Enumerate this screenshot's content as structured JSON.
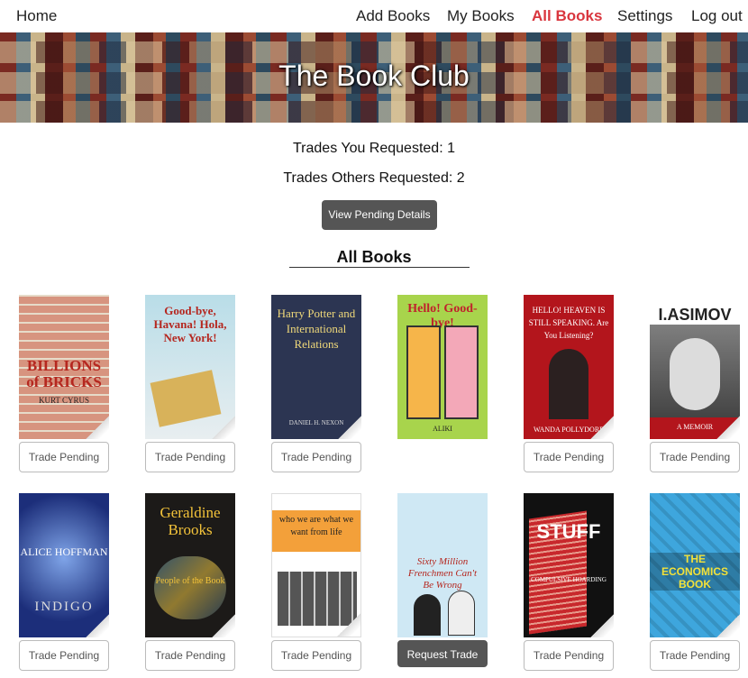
{
  "nav": {
    "home": "Home",
    "add_books": "Add Books",
    "my_books": "My Books",
    "all_books": "All Books",
    "settings": "Settings",
    "logout": "Log out",
    "active_color": "#d9363e"
  },
  "hero": {
    "title": "The Book Club"
  },
  "stats": {
    "requested": "Trades You Requested: 1",
    "others": "Trades Others Requested: 2"
  },
  "pending_button": "View Pending Details",
  "section_title": "All Books",
  "books": [
    {
      "cover_text": "BILLIONS of BRICKS",
      "cover_sub": "KURT CYRUS",
      "action": "Trade Pending"
    },
    {
      "cover_text": "Good-bye, Havana! Hola, New York!",
      "cover_sub": "",
      "action": "Trade Pending"
    },
    {
      "cover_text": "Harry Potter and International Relations",
      "cover_sub": "DANIEL H. NEXON",
      "action": "Trade Pending"
    },
    {
      "cover_text": "Hello! Good-bye!",
      "cover_sub": "ALIKI",
      "action": ""
    },
    {
      "cover_text": "HELLO! HEAVEN IS STILL SPEAKING. Are You Listening?",
      "cover_sub": "WANDA POLLYDORE",
      "action": "Trade Pending"
    },
    {
      "cover_text": "I.ASIMOV",
      "cover_sub": "A MEMOIR",
      "action": "Trade Pending"
    },
    {
      "cover_text": "INDIGO",
      "cover_sub": "ALICE HOFFMAN",
      "action": "Trade Pending"
    },
    {
      "cover_text": "Geraldine Brooks",
      "cover_sub": "People of the Book",
      "action": "Trade Pending"
    },
    {
      "cover_text": "who we are what we want from life",
      "cover_sub": "",
      "action": "Trade Pending"
    },
    {
      "cover_text": "Sixty Million Frenchmen Can't Be Wrong",
      "cover_sub": "",
      "action": "Request Trade"
    },
    {
      "cover_text": "STUFF",
      "cover_sub": "COMPULSIVE HOARDING",
      "action": "Trade Pending"
    },
    {
      "cover_text": "THE ECONOMICS BOOK",
      "cover_sub": "",
      "action": "Trade Pending"
    }
  ]
}
